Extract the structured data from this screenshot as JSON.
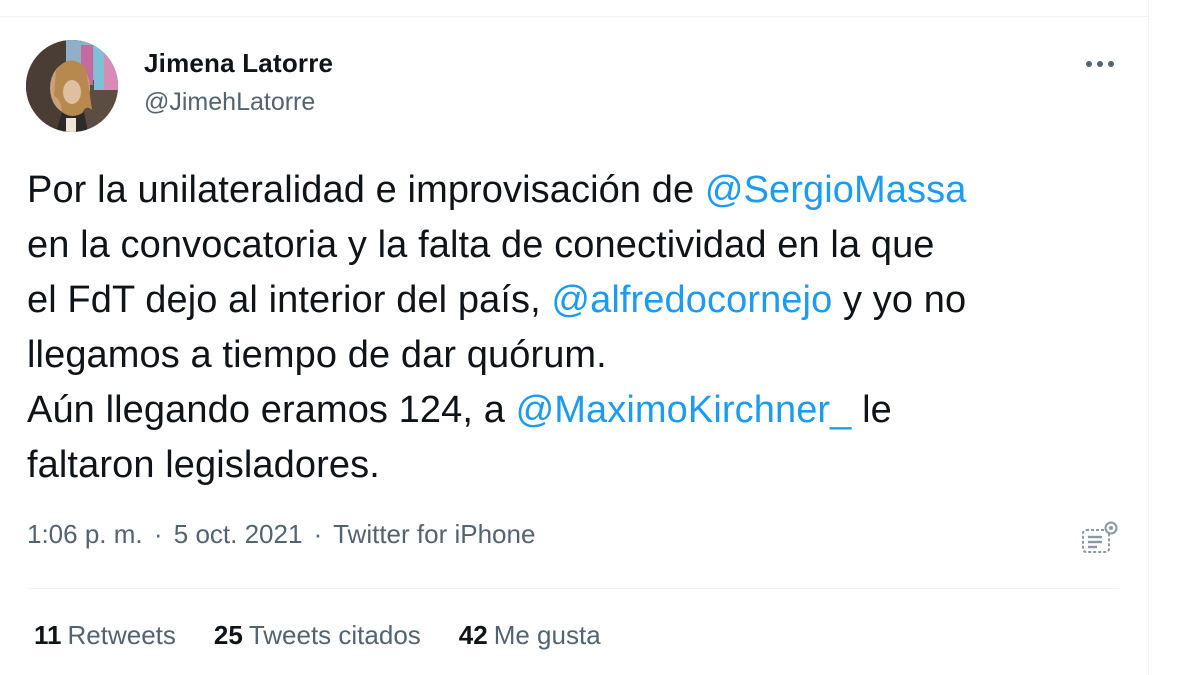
{
  "tweet": {
    "author": {
      "display_name": "Jimena Latorre",
      "handle": "@JimehLatorre",
      "avatar_icon": "profile-photo"
    },
    "more_icon": "more-horizontal-icon",
    "text": {
      "line1": {
        "t1": "Por la unilateralidad e improvisación de ",
        "m1": "@SergioMassa"
      },
      "line2": {
        "t1": "en la convocatoria y la falta de conectividad en la que"
      },
      "line3": {
        "t1": "el FdT dejo al interior del país, ",
        "m1": "@alfredocornejo",
        "t2": " y yo no"
      },
      "line4": {
        "t1": "llegamos a tiempo de dar quórum."
      },
      "line5": {
        "t1": "Aún llegando eramos 124, a ",
        "m1": "@MaximoKirchner_",
        "t2": " le"
      },
      "line6": {
        "t1": "faltaron legisladores."
      }
    },
    "meta": {
      "time": "1:06 p. m.",
      "separator": "·",
      "date": "5 oct. 2021",
      "source": "Twitter for iPhone"
    },
    "analytics_icon": "analytics-icon",
    "stats": {
      "retweets_count": "11",
      "retweets_label": "Retweets",
      "quotes_count": "25",
      "quotes_label": "Tweets citados",
      "likes_count": "42",
      "likes_label": "Me gusta"
    },
    "colors": {
      "text": "#0f1419",
      "secondary": "#536471",
      "mention": "#1d9bf0",
      "divider": "#eff3f4"
    }
  }
}
